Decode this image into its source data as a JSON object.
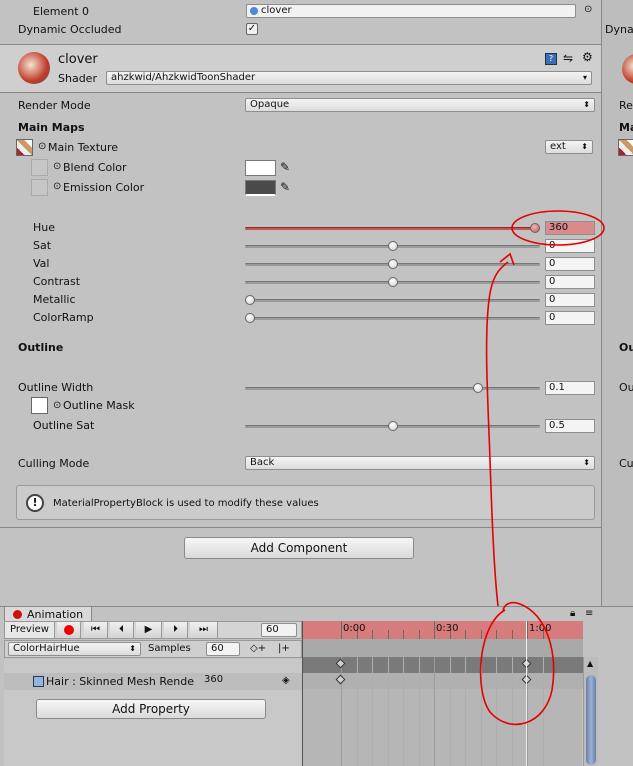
{
  "top": {
    "element0_label": "Element 0",
    "element0_value": "clover",
    "dynamic_occluded_label": "Dynamic Occluded",
    "dynamic_occluded_checked": true
  },
  "material": {
    "name": "clover",
    "shader_label": "Shader",
    "shader_value": "ahzkwid/AhzkwidToonShader"
  },
  "render_mode": {
    "label": "Render Mode",
    "value": "Opaque"
  },
  "main_maps": {
    "header": "Main Maps",
    "main_texture_label": "Main Texture",
    "main_texture_dropdown": "ext",
    "blend_color_label": "Blend Color",
    "blend_color": "#ffffff",
    "emission_color_label": "Emission Color",
    "emission_color": "#4a4a4a"
  },
  "sliders": [
    {
      "label": "Hue",
      "value": "360",
      "fraction": 1.0,
      "highlight": true
    },
    {
      "label": "Sat",
      "value": "0",
      "fraction": 0.5,
      "highlight": false
    },
    {
      "label": "Val",
      "value": "0",
      "fraction": 0.5,
      "highlight": false
    },
    {
      "label": "Contrast",
      "value": "0",
      "fraction": 0.5,
      "highlight": false
    },
    {
      "label": "Metallic",
      "value": "0",
      "fraction": 0.0,
      "highlight": false
    },
    {
      "label": "ColorRamp",
      "value": "0",
      "fraction": 0.0,
      "highlight": false
    }
  ],
  "outline": {
    "header": "Outline",
    "width_label": "Outline Width",
    "width_value": "0.1",
    "width_fraction": 0.8,
    "mask_label": "Outline Mask",
    "sat_label": "Outline Sat",
    "sat_value": "0.5",
    "sat_fraction": 0.5
  },
  "culling": {
    "label": "Culling Mode",
    "value": "Back"
  },
  "info_message": "MaterialPropertyBlock is used to modify these values",
  "add_component_label": "Add Component",
  "animation": {
    "tab_label": "Animation",
    "preview_label": "Preview",
    "frame_value": "60",
    "clip_name": "ColorHairHue",
    "samples_label": "Samples",
    "samples_value": "60",
    "timeline_labels": [
      "0:00",
      "0:30",
      "1:00"
    ],
    "property_label": "Hair : Skinned Mesh Rende",
    "property_value": "360",
    "add_property_label": "Add Property"
  },
  "colors": {
    "accent_red": "#e60000",
    "hue_highlight": "#d98a8a",
    "timeline_header": "#d77c7c"
  }
}
